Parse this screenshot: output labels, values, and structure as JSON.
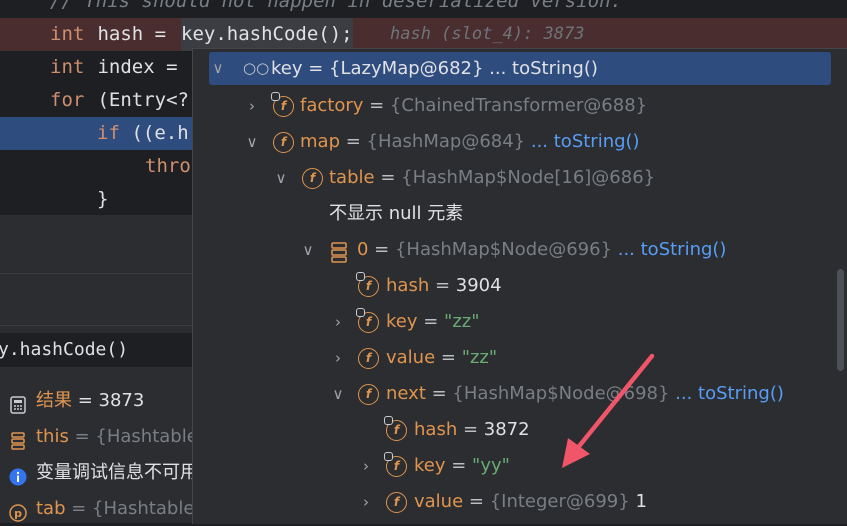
{
  "editor": {
    "lines": [
      {
        "a": "// This should not happen in deserialized version."
      },
      {
        "kw": "int",
        "rest1": " hash = ",
        "rest2": "key.hashCode();",
        "hint": "hash (slot_4): 3873"
      },
      {
        "kw": "int",
        "rest1": " index = "
      },
      {
        "kw": "for",
        "rest1": " (Entry<?"
      },
      {
        "kw": "if",
        "rest1": " ((e.h"
      },
      {
        "kw": "thro"
      },
      {
        "a": "}"
      }
    ]
  },
  "left_panel": {
    "expression": "y.hashCode()",
    "vars": [
      {
        "name": "结果",
        "value": " = 3873",
        "icon": "calculator-icon"
      },
      {
        "name": "this",
        "value": " = {Hashtable@",
        "icon": "object-icon"
      },
      {
        "name": "变量调试信息不可用",
        "value": "",
        "icon": "info-icon"
      },
      {
        "name": "tab",
        "value": " = {Hashtable$",
        "icon": "parameter-icon"
      }
    ]
  },
  "popup": {
    "rows": [
      {
        "name": "key",
        "eq": " = ",
        "value": "{LazyMap@682}",
        "link": " ... toString()"
      },
      {
        "name": "factory",
        "eq": " = ",
        "value": "{ChainedTransformer@688}"
      },
      {
        "name": "map",
        "eq": " = ",
        "value": "{HashMap@684}",
        "link": " ... toString()"
      },
      {
        "name": "table",
        "eq": " = ",
        "value": "{HashMap$Node[16]@686}"
      },
      {
        "name": "不显示 null 元素"
      },
      {
        "name": "0",
        "eq": " = ",
        "value": "{HashMap$Node@696}",
        "link": " ... toString()"
      },
      {
        "name": "hash",
        "eq": " = ",
        "num": "3904"
      },
      {
        "name": "key",
        "eq": " = ",
        "str": "\"zz\""
      },
      {
        "name": "value",
        "eq": " = ",
        "str": "\"zz\""
      },
      {
        "name": "next",
        "eq": " = ",
        "value": "{HashMap$Node@698}",
        "link": " ... toString()"
      },
      {
        "name": "hash",
        "eq": " = ",
        "num": "3872"
      },
      {
        "name": "key",
        "eq": " = ",
        "str": "\"yy\""
      },
      {
        "name": "value",
        "eq": " = ",
        "value": "{Integer@699}",
        "num": " 1"
      }
    ]
  },
  "colors": {
    "accent": "#2e4c7e",
    "error_line": "#4a2d2f",
    "arrow": "#f0556a"
  }
}
